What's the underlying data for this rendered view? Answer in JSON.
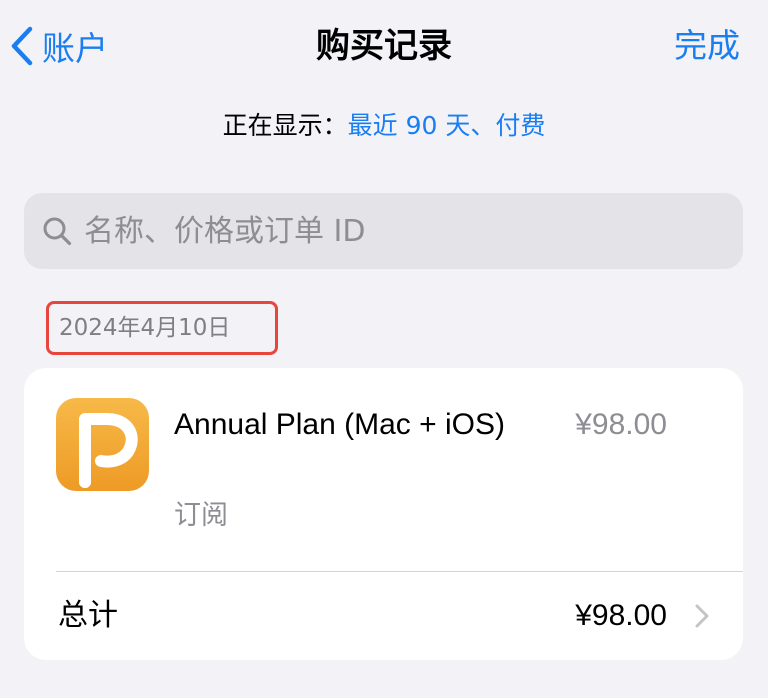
{
  "nav": {
    "back_label": "账户",
    "title": "购买记录",
    "done_label": "完成"
  },
  "filter": {
    "prefix": "正在显示：",
    "value": "最近 90 天、付费"
  },
  "search": {
    "placeholder": "名称、价格或订单 ID",
    "value": ""
  },
  "purchases": {
    "date": "2024年4月10日",
    "item": {
      "title": "Annual Plan (Mac + iOS)",
      "type": "订阅",
      "price": "¥98.00",
      "icon": "app-icon-orange-p"
    },
    "total_label": "总计",
    "total_value": "¥98.00"
  },
  "colors": {
    "accent": "#1a7ef2",
    "background": "#f2f2f7",
    "highlight_box": "#e8453c",
    "app_icon": "#f2a532"
  }
}
